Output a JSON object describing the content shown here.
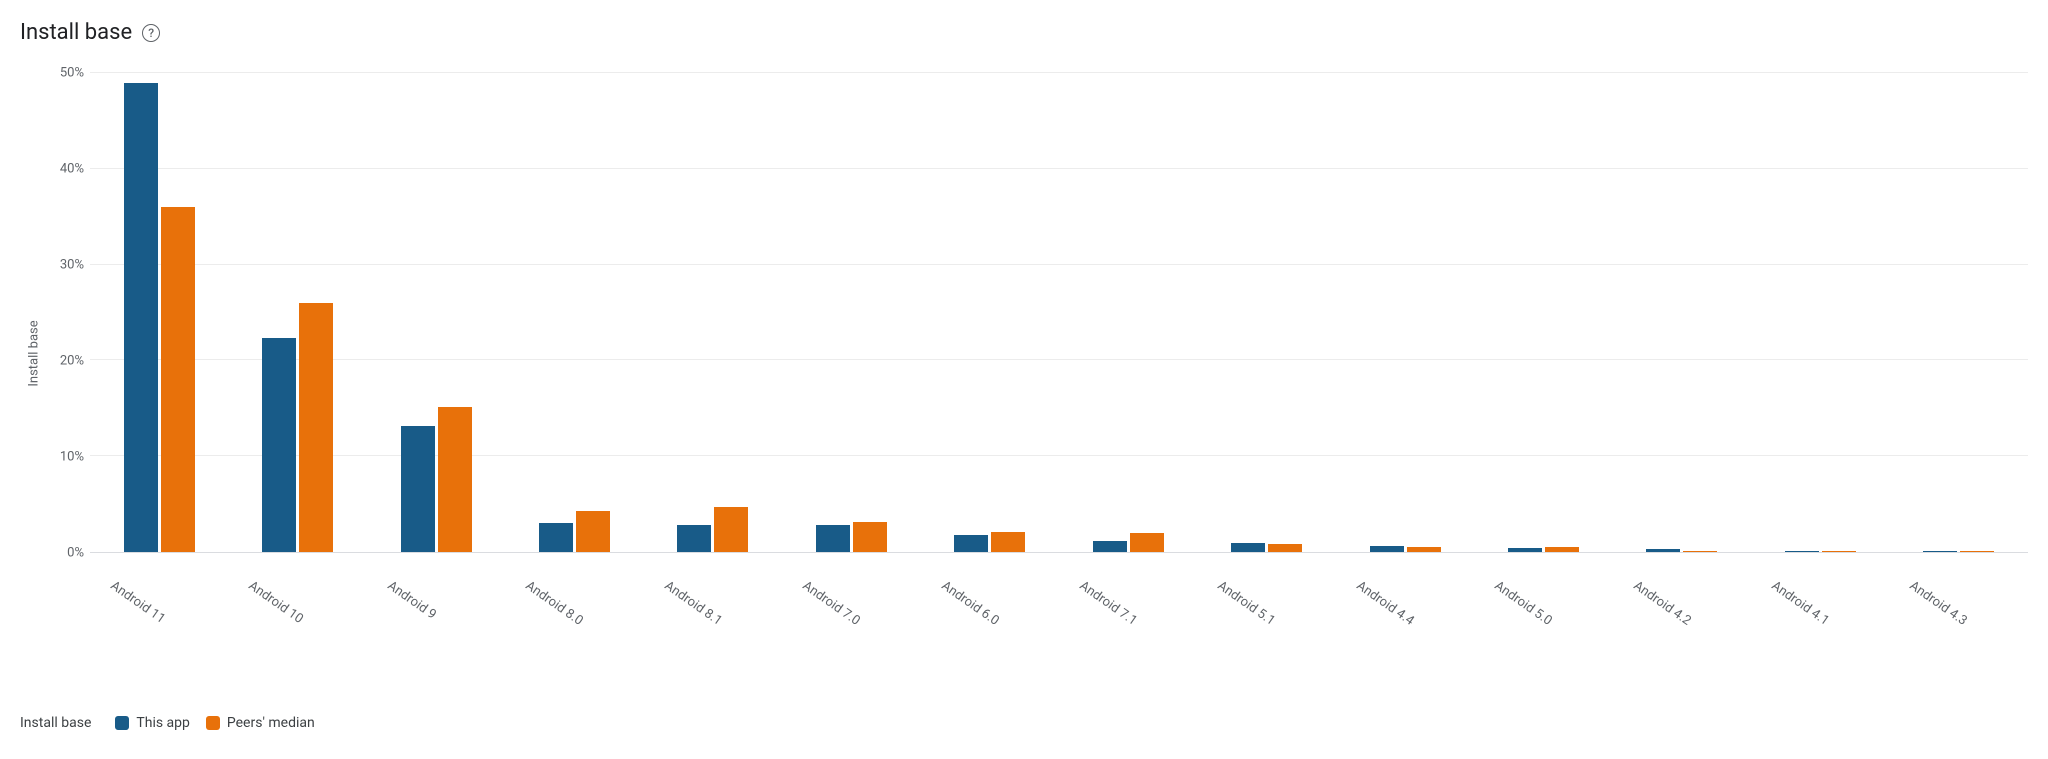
{
  "title": "Install base",
  "help_icon_label": "?",
  "y_axis_label": "Install base",
  "legend": {
    "title": "Install base",
    "series_a": "This app",
    "series_b": "Peers' median"
  },
  "y_ticks": [
    "0%",
    "10%",
    "20%",
    "30%",
    "40%",
    "50%"
  ],
  "chart_data": {
    "type": "bar",
    "title": "Install base",
    "xlabel": "",
    "ylabel": "Install base",
    "ylim": [
      0,
      50
    ],
    "y_unit": "%",
    "categories": [
      "Android 11",
      "Android 10",
      "Android 9",
      "Android 8.0",
      "Android 8.1",
      "Android 7.0",
      "Android 6.0",
      "Android 7.1",
      "Android 5.1",
      "Android 4.4",
      "Android 5.0",
      "Android 4.2",
      "Android 4.1",
      "Android 4.3"
    ],
    "series": [
      {
        "name": "This app",
        "color": "#185b88",
        "values": [
          49.0,
          22.3,
          13.2,
          3.0,
          2.8,
          2.8,
          1.8,
          1.2,
          0.9,
          0.6,
          0.4,
          0.3,
          0.1,
          0.1
        ]
      },
      {
        "name": "Peers' median",
        "color": "#e8710a",
        "values": [
          36.0,
          26.0,
          15.1,
          4.3,
          4.7,
          3.1,
          2.1,
          2.0,
          0.8,
          0.5,
          0.5,
          0.1,
          0.1,
          0.1
        ]
      }
    ]
  }
}
